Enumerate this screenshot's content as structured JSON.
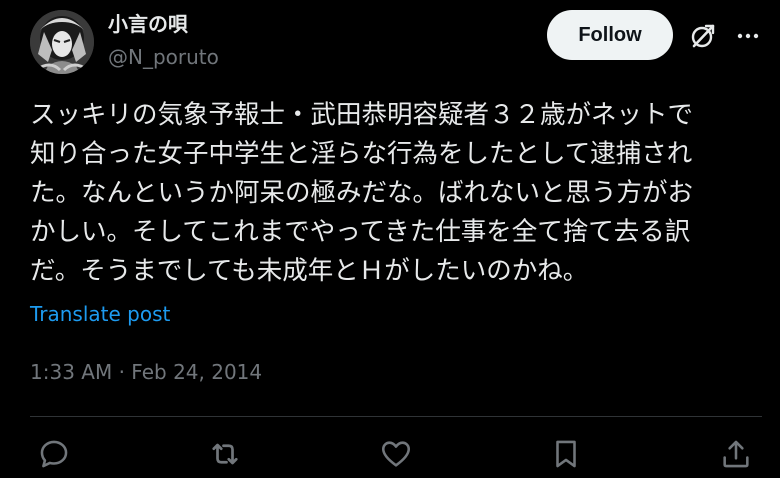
{
  "author": {
    "display_name": "小言の唄",
    "handle": "@N_poruto",
    "avatar_icon": "avatar-image"
  },
  "header": {
    "follow_label": "Follow",
    "grok_icon": "grok-icon",
    "more_icon": "more-icon"
  },
  "post": {
    "lines": [
      "スッキリの気象予報士・武田恭明容疑者３２歳がネットで",
      "知り合った女子中学生と淫らな行為をしたとして逮捕され",
      "た。なんというか阿呆の極みだな。ばれないと思う方がお",
      "かしい。そしてこれまでやってきた仕事を全て捨て去る訳",
      "だ。そうまでしても未成年とＨがしたいのかね。"
    ],
    "translate_label": "Translate post",
    "time": "1:33 AM",
    "separator": " · ",
    "date": "Feb 24, 2014"
  },
  "actions": {
    "reply_icon": "reply-icon",
    "repost_icon": "repost-icon",
    "like_icon": "heart-icon",
    "bookmark_icon": "bookmark-icon",
    "share_icon": "share-icon"
  },
  "colors": {
    "background": "#000000",
    "text": "#e7e9ea",
    "muted": "#71767b",
    "link": "#1d9bf0",
    "divider": "#2f3336",
    "button_bg": "#eff3f4"
  }
}
